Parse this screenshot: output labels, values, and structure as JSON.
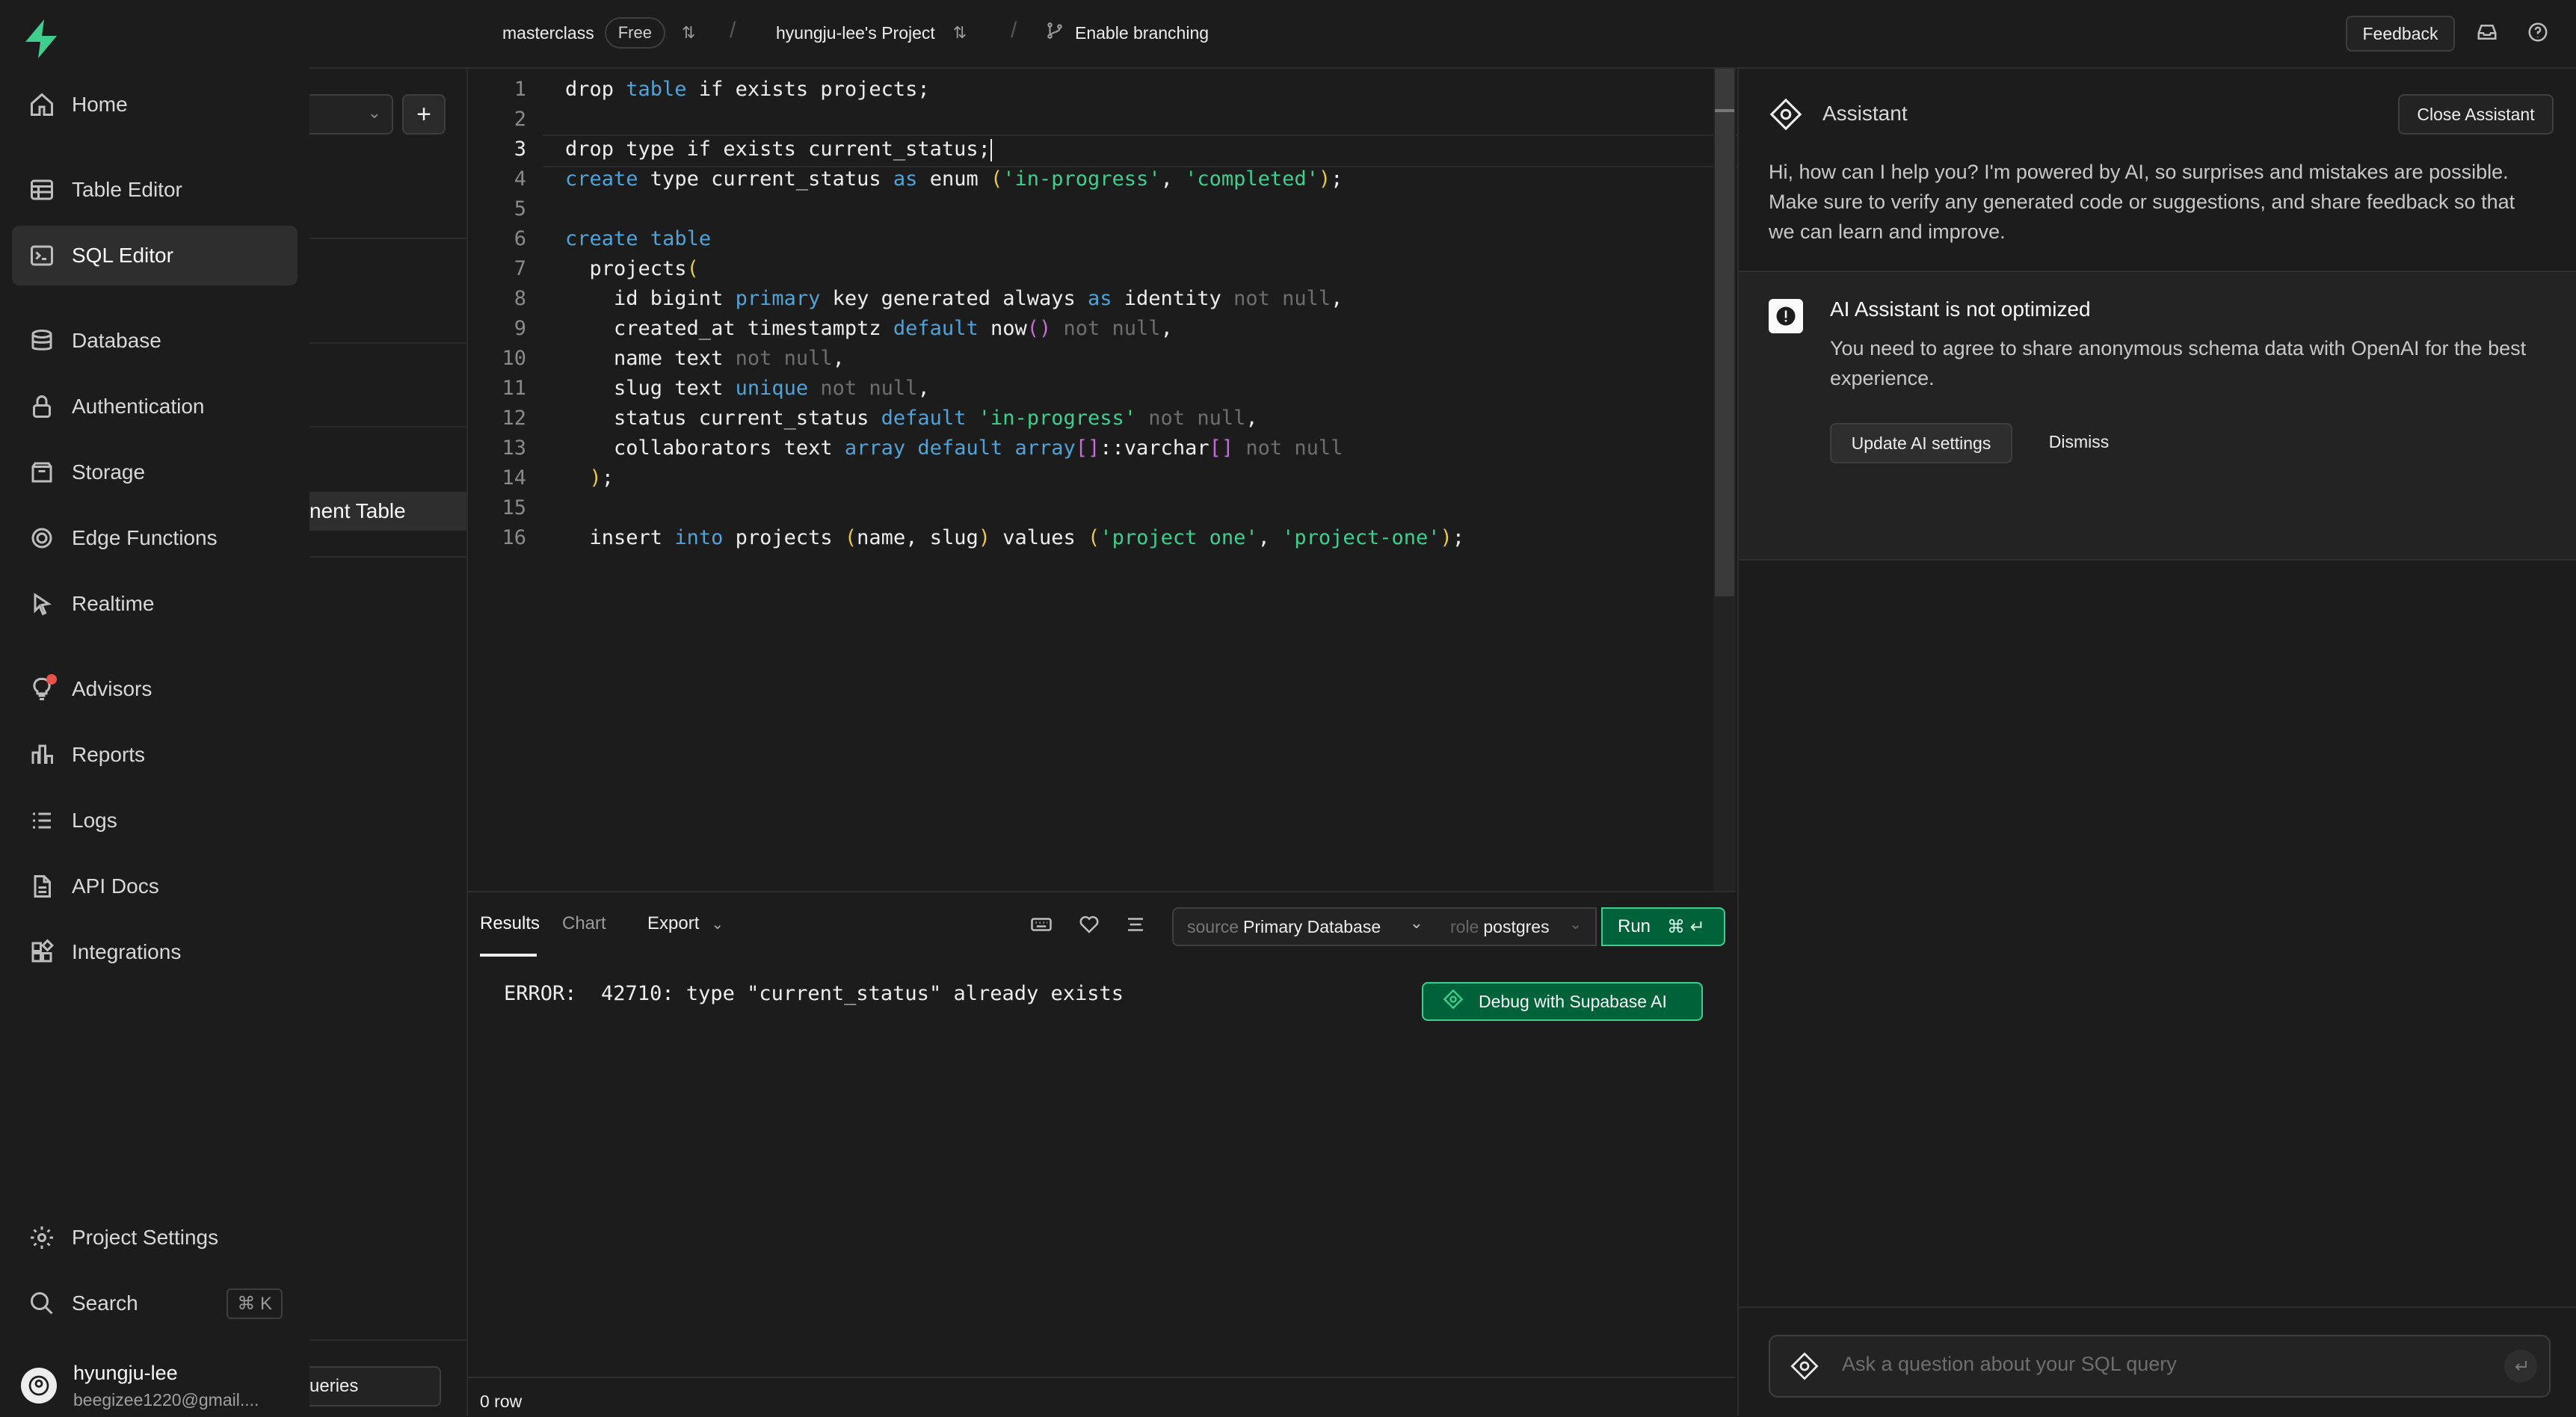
{
  "topbar": {
    "org": "masterclass",
    "plan": "Free",
    "project": "hyungju-lee's Project",
    "branching": "Enable branching",
    "feedback": "Feedback"
  },
  "nav": {
    "items": [
      {
        "label": "Home",
        "icon": "home-icon"
      },
      {
        "label": "Table Editor",
        "icon": "table-icon"
      },
      {
        "label": "SQL Editor",
        "icon": "terminal-icon"
      },
      {
        "label": "Database",
        "icon": "database-icon"
      },
      {
        "label": "Authentication",
        "icon": "lock-icon"
      },
      {
        "label": "Storage",
        "icon": "archive-icon"
      },
      {
        "label": "Edge Functions",
        "icon": "functions-icon"
      },
      {
        "label": "Realtime",
        "icon": "cursor-icon"
      },
      {
        "label": "Advisors",
        "icon": "lightbulb-icon"
      },
      {
        "label": "Reports",
        "icon": "reports-icon"
      },
      {
        "label": "Logs",
        "icon": "list-icon"
      },
      {
        "label": "API Docs",
        "icon": "file-icon"
      },
      {
        "label": "Integrations",
        "icon": "blocks-icon"
      }
    ],
    "settings": "Project Settings",
    "search": "Search",
    "search_shortcut": "⌘ K",
    "user_name": "hyungju-lee",
    "user_email": "beegizee1220@gmail...."
  },
  "secondary": {
    "active_item": "nent Table",
    "queries_button": "ueries"
  },
  "editor": {
    "lines": [
      "drop table if exists projects;",
      "",
      "drop type if exists current_status;",
      "create type current_status as enum ('in-progress', 'completed');",
      "",
      "create table",
      "  projects(",
      "    id bigint primary key generated always as identity not null,",
      "    created_at timestamptz default now() not null,",
      "    name text not null,",
      "    slug text unique not null,",
      "    status current_status default 'in-progress' not null,",
      "    collaborators text array default array[]::varchar[] not null",
      "  );",
      "",
      "  insert into projects (name, slug) values ('project one', 'project-one');"
    ]
  },
  "results": {
    "tabs": [
      "Results",
      "Chart"
    ],
    "export": "Export",
    "source_label": "source",
    "source_value": "Primary Database",
    "role_label": "role",
    "role_value": "postgres",
    "run": "Run",
    "run_shortcut": "⌘ ↵",
    "error": "ERROR:  42710: type \"current_status\" already exists",
    "debug_button": "Debug with Supabase AI",
    "row_count": "0 row"
  },
  "assistant": {
    "title": "Assistant",
    "close": "Close Assistant",
    "intro": "Hi, how can I help you? I'm powered by AI, so surprises and mistakes are possible. Make sure to verify any generated code or suggestions, and share feedback so that we can learn and improve.",
    "warning_title": "AI Assistant is not optimized",
    "warning_body": "You need to agree to share anonymous schema data with OpenAI for the best experience.",
    "update_button": "Update AI settings",
    "dismiss_button": "Dismiss",
    "input_placeholder": "Ask a question about your SQL query"
  },
  "colors": {
    "brand": "#3ecf8e",
    "run_button": "#006239",
    "active_nav": "#2e2e2e"
  }
}
